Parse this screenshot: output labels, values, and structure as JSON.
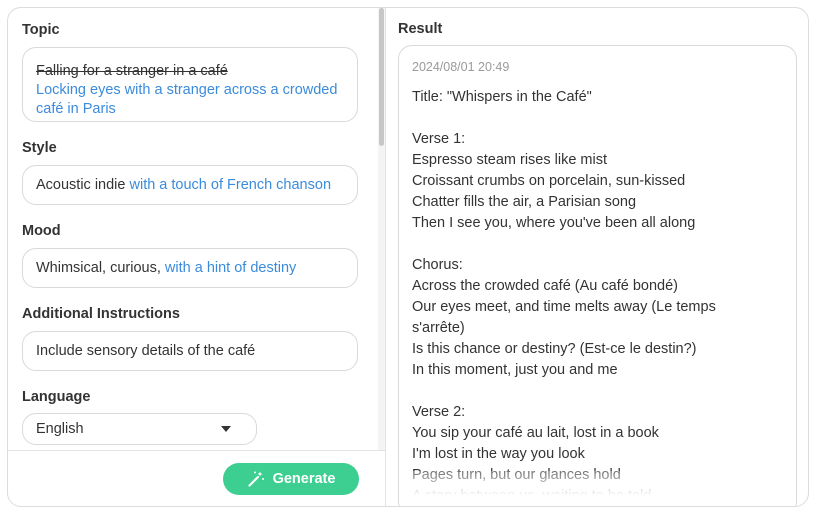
{
  "form": {
    "topic": {
      "label": "Topic",
      "original": "Falling for a stranger in a café",
      "suggestion": "Locking eyes with a stranger across a crowded café in Paris"
    },
    "style": {
      "label": "Style",
      "base": "Acoustic indie",
      "suggestion": " with a touch of French chanson"
    },
    "mood": {
      "label": "Mood",
      "base": "Whimsical, curious,",
      "suggestion": " with a hint of destiny"
    },
    "additional": {
      "label": "Additional Instructions",
      "value": "Include sensory details of the café"
    },
    "language": {
      "label": "Language",
      "selected": "English"
    },
    "generate_label": "Generate"
  },
  "result": {
    "label": "Result",
    "timestamp": "2024/08/01 20:49",
    "text": "Title: \"Whispers in the Café\"\n\nVerse 1:\nEspresso steam rises like mist\nCroissant crumbs on porcelain, sun-kissed\nChatter fills the air, a Parisian song\nThen I see you, where you've been all along\n\nChorus:\nAcross the crowded café (Au café bondé)\nOur eyes meet, and time melts away (Le temps s'arrête)\nIs this chance or destiny? (Est-ce le destin?)\nIn this moment, just you and me\n\nVerse 2:\nYou sip your café au lait, lost in a book\nI'm lost in the way you look\nPages turn, but our glances hold\nA story between us, waiting to be told"
  },
  "colors": {
    "accent_blue": "#3a8bdc",
    "generate_green": "#3ccf91"
  },
  "icons": {
    "generate": "magic-wand-icon",
    "dropdown": "caret-down-icon"
  }
}
